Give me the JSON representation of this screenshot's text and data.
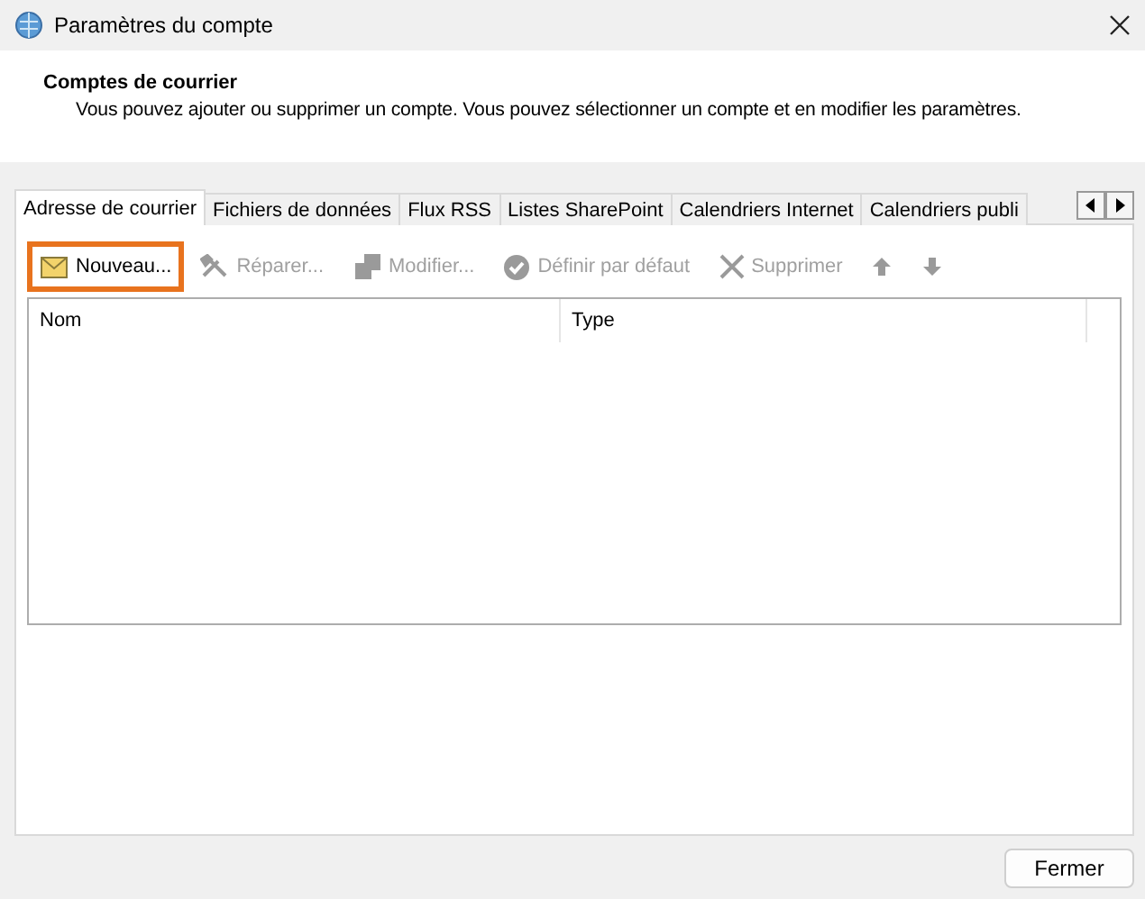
{
  "window": {
    "title": "Paramètres du compte"
  },
  "header": {
    "title": "Comptes de courrier",
    "description": "Vous pouvez ajouter ou supprimer un compte. Vous pouvez sélectionner un compte et en modifier les paramètres."
  },
  "tabs": [
    {
      "label": "Adresse de courrier",
      "selected": true
    },
    {
      "label": "Fichiers de données",
      "selected": false
    },
    {
      "label": "Flux RSS",
      "selected": false
    },
    {
      "label": "Listes SharePoint",
      "selected": false
    },
    {
      "label": "Calendriers Internet",
      "selected": false
    },
    {
      "label": "Calendriers publi",
      "selected": false
    }
  ],
  "toolbar": [
    {
      "kind": "new",
      "label": "Nouveau...",
      "disabled": false,
      "highlighted": true
    },
    {
      "kind": "repair",
      "label": "Réparer...",
      "disabled": true,
      "highlighted": false
    },
    {
      "kind": "change",
      "label": "Modifier...",
      "disabled": true,
      "highlighted": false
    },
    {
      "kind": "default",
      "label": "Définir par défaut",
      "disabled": true,
      "highlighted": false
    },
    {
      "kind": "remove",
      "label": "Supprimer",
      "disabled": true,
      "highlighted": false
    },
    {
      "kind": "up",
      "disabled": true,
      "highlighted": false
    },
    {
      "kind": "down",
      "disabled": true,
      "highlighted": false
    }
  ],
  "table": {
    "columns": [
      "Nom",
      "Type"
    ]
  },
  "buttons": [
    "Fermer"
  ]
}
